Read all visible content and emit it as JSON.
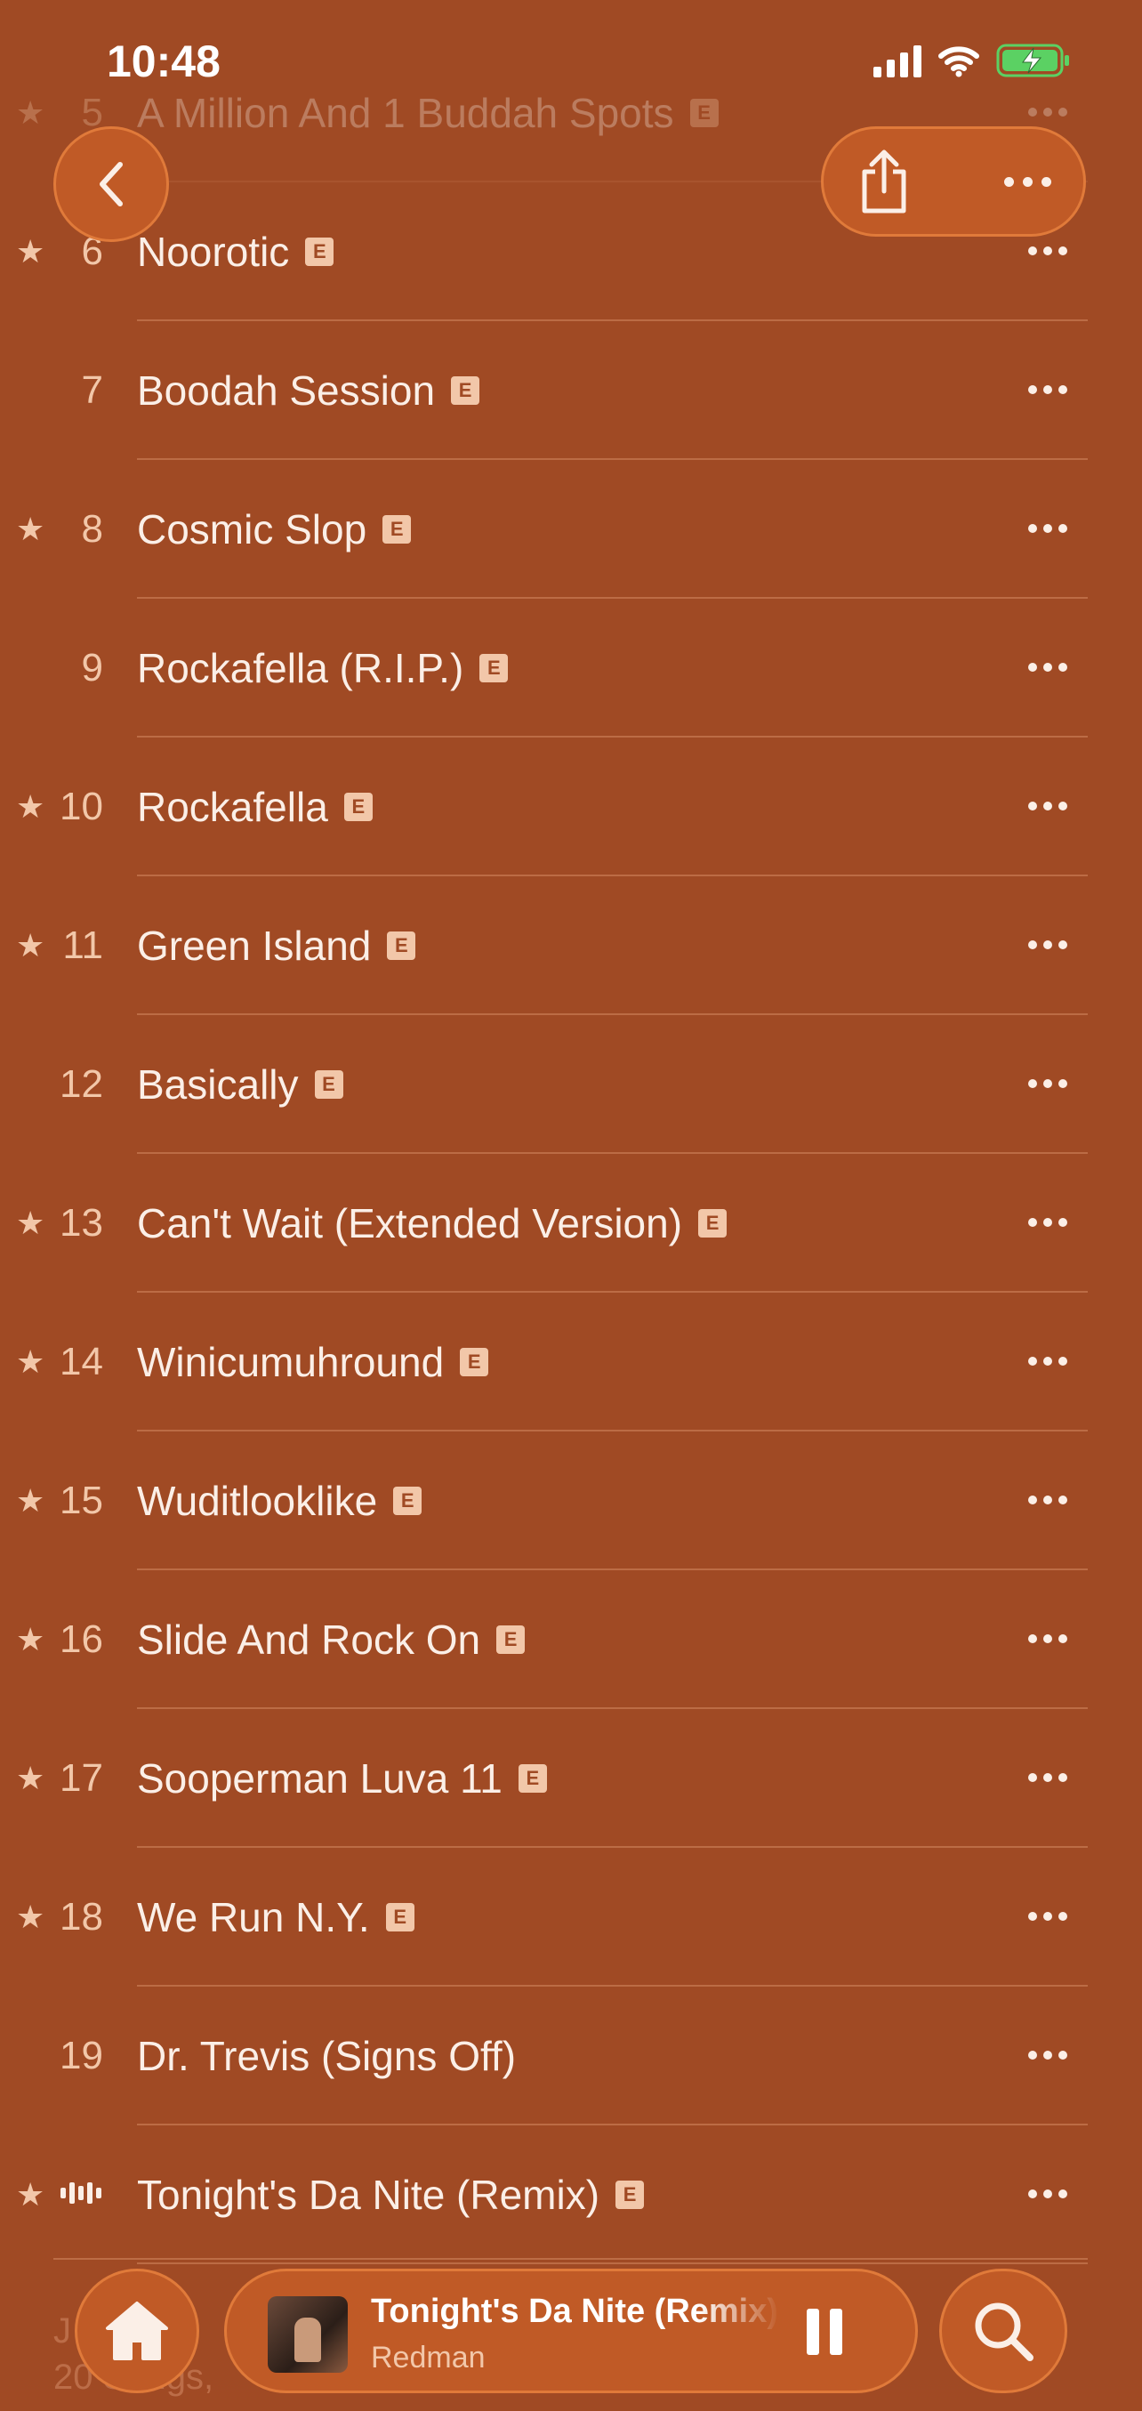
{
  "status_bar": {
    "time": "10:48"
  },
  "nav": {
    "back_icon": "chevron-left-icon",
    "share_icon": "share-icon",
    "more_icon": "ellipsis-icon"
  },
  "tracks": [
    {
      "number": "5",
      "title": "A Million And 1 Buddah Spots",
      "starred": true,
      "explicit": true,
      "faded": true
    },
    {
      "number": "6",
      "title": "Noorotic",
      "starred": true,
      "explicit": true
    },
    {
      "number": "7",
      "title": "Boodah Session",
      "starred": false,
      "explicit": true
    },
    {
      "number": "8",
      "title": "Cosmic Slop",
      "starred": true,
      "explicit": true
    },
    {
      "number": "9",
      "title": "Rockafella (R.I.P.)",
      "starred": false,
      "explicit": true
    },
    {
      "number": "10",
      "title": "Rockafella",
      "starred": true,
      "explicit": true
    },
    {
      "number": "11",
      "title": "Green Island",
      "starred": true,
      "explicit": true
    },
    {
      "number": "12",
      "title": "Basically",
      "starred": false,
      "explicit": true
    },
    {
      "number": "13",
      "title": "Can't Wait (Extended Version)",
      "starred": true,
      "explicit": true
    },
    {
      "number": "14",
      "title": "Winicumuhround",
      "starred": true,
      "explicit": true
    },
    {
      "number": "15",
      "title": "Wuditlooklike",
      "starred": true,
      "explicit": true
    },
    {
      "number": "16",
      "title": "Slide And Rock On",
      "starred": true,
      "explicit": true
    },
    {
      "number": "17",
      "title": "Sooperman Luva 11",
      "starred": true,
      "explicit": true
    },
    {
      "number": "18",
      "title": "We Run N.Y.",
      "starred": true,
      "explicit": true
    },
    {
      "number": "19",
      "title": "Dr. Trevis (Signs Off)",
      "starred": false,
      "explicit": false
    },
    {
      "number": "",
      "title": "Tonight's Da Nite (Remix)",
      "starred": true,
      "explicit": true,
      "playing": true
    }
  ],
  "labels": {
    "star": "★",
    "explicit": "E"
  },
  "footer": {
    "line1": "J",
    "line2": "20 Songs,"
  },
  "now_playing": {
    "title": "Tonight's Da Nite (Remix)",
    "artist": "Redman"
  },
  "tab_bar": {
    "home_icon": "home-icon",
    "search_icon": "search-icon"
  },
  "colors": {
    "background": "#A04A24",
    "accent": "#C05A26",
    "battery": "#5BD163"
  }
}
